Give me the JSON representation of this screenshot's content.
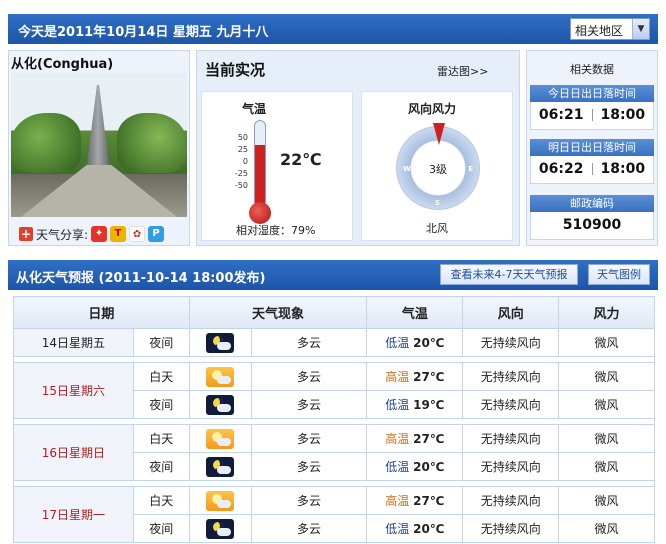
{
  "header": {
    "date_text": "今天是2011年10月14日  星期五  九月十八",
    "region_label": "相关地区"
  },
  "city": {
    "name": "从化(Conghua)",
    "share_label": "天气分享:"
  },
  "current": {
    "title": "当前实况",
    "radar_link": "雷达图>>",
    "temp_heading": "气温",
    "scale": [
      "50",
      "25",
      "0",
      "-25",
      "-50"
    ],
    "temp_value": "22℃",
    "temp_level": 0.72,
    "humidity": "相对湿度：79%",
    "wind_heading": "风向风力",
    "wind_level": "3级",
    "wind_dir": "北风"
  },
  "related": {
    "title": "相关数据",
    "today_sun_label": "今日日出日落时间",
    "today_rise": "06:21",
    "today_set": "18:00",
    "tomorrow_sun_label": "明日日出日落时间",
    "tomorrow_rise": "06:22",
    "tomorrow_set": "18:00",
    "postcode_label": "邮政编码",
    "postcode": "510900"
  },
  "forecast": {
    "title": "从化天气预报  (2011-10-14  18:00发布)",
    "btn_more": "查看未来4-7天天气预报",
    "btn_legend": "天气图例",
    "columns": [
      "日期",
      "天气现象",
      "气温",
      "风向",
      "风力"
    ],
    "days": [
      {
        "date": "14日星期五",
        "rows": [
          {
            "period": "夜间",
            "weather": "多云",
            "temp_label": "低温",
            "temp": "20℃",
            "wind_dir": "无持续风向",
            "wind_force": "微风"
          }
        ]
      },
      {
        "date": "15日星期六",
        "rows": [
          {
            "period": "白天",
            "weather": "多云",
            "temp_label": "高温",
            "temp": "27℃",
            "wind_dir": "无持续风向",
            "wind_force": "微风"
          },
          {
            "period": "夜间",
            "weather": "多云",
            "temp_label": "低温",
            "temp": "19℃",
            "wind_dir": "无持续风向",
            "wind_force": "微风"
          }
        ]
      },
      {
        "date": "16日星期日",
        "rows": [
          {
            "period": "白天",
            "weather": "多云",
            "temp_label": "高温",
            "temp": "27℃",
            "wind_dir": "无持续风向",
            "wind_force": "微风"
          },
          {
            "period": "夜间",
            "weather": "多云",
            "temp_label": "低温",
            "temp": "20℃",
            "wind_dir": "无持续风向",
            "wind_force": "微风"
          }
        ]
      },
      {
        "date": "17日星期一",
        "rows": [
          {
            "period": "白天",
            "weather": "多云",
            "temp_label": "高温",
            "temp": "27℃",
            "wind_dir": "无持续风向",
            "wind_force": "微风"
          },
          {
            "period": "夜间",
            "weather": "多云",
            "temp_label": "低温",
            "temp": "20℃",
            "wind_dir": "无持续风向",
            "wind_force": "微风"
          }
        ]
      }
    ]
  }
}
